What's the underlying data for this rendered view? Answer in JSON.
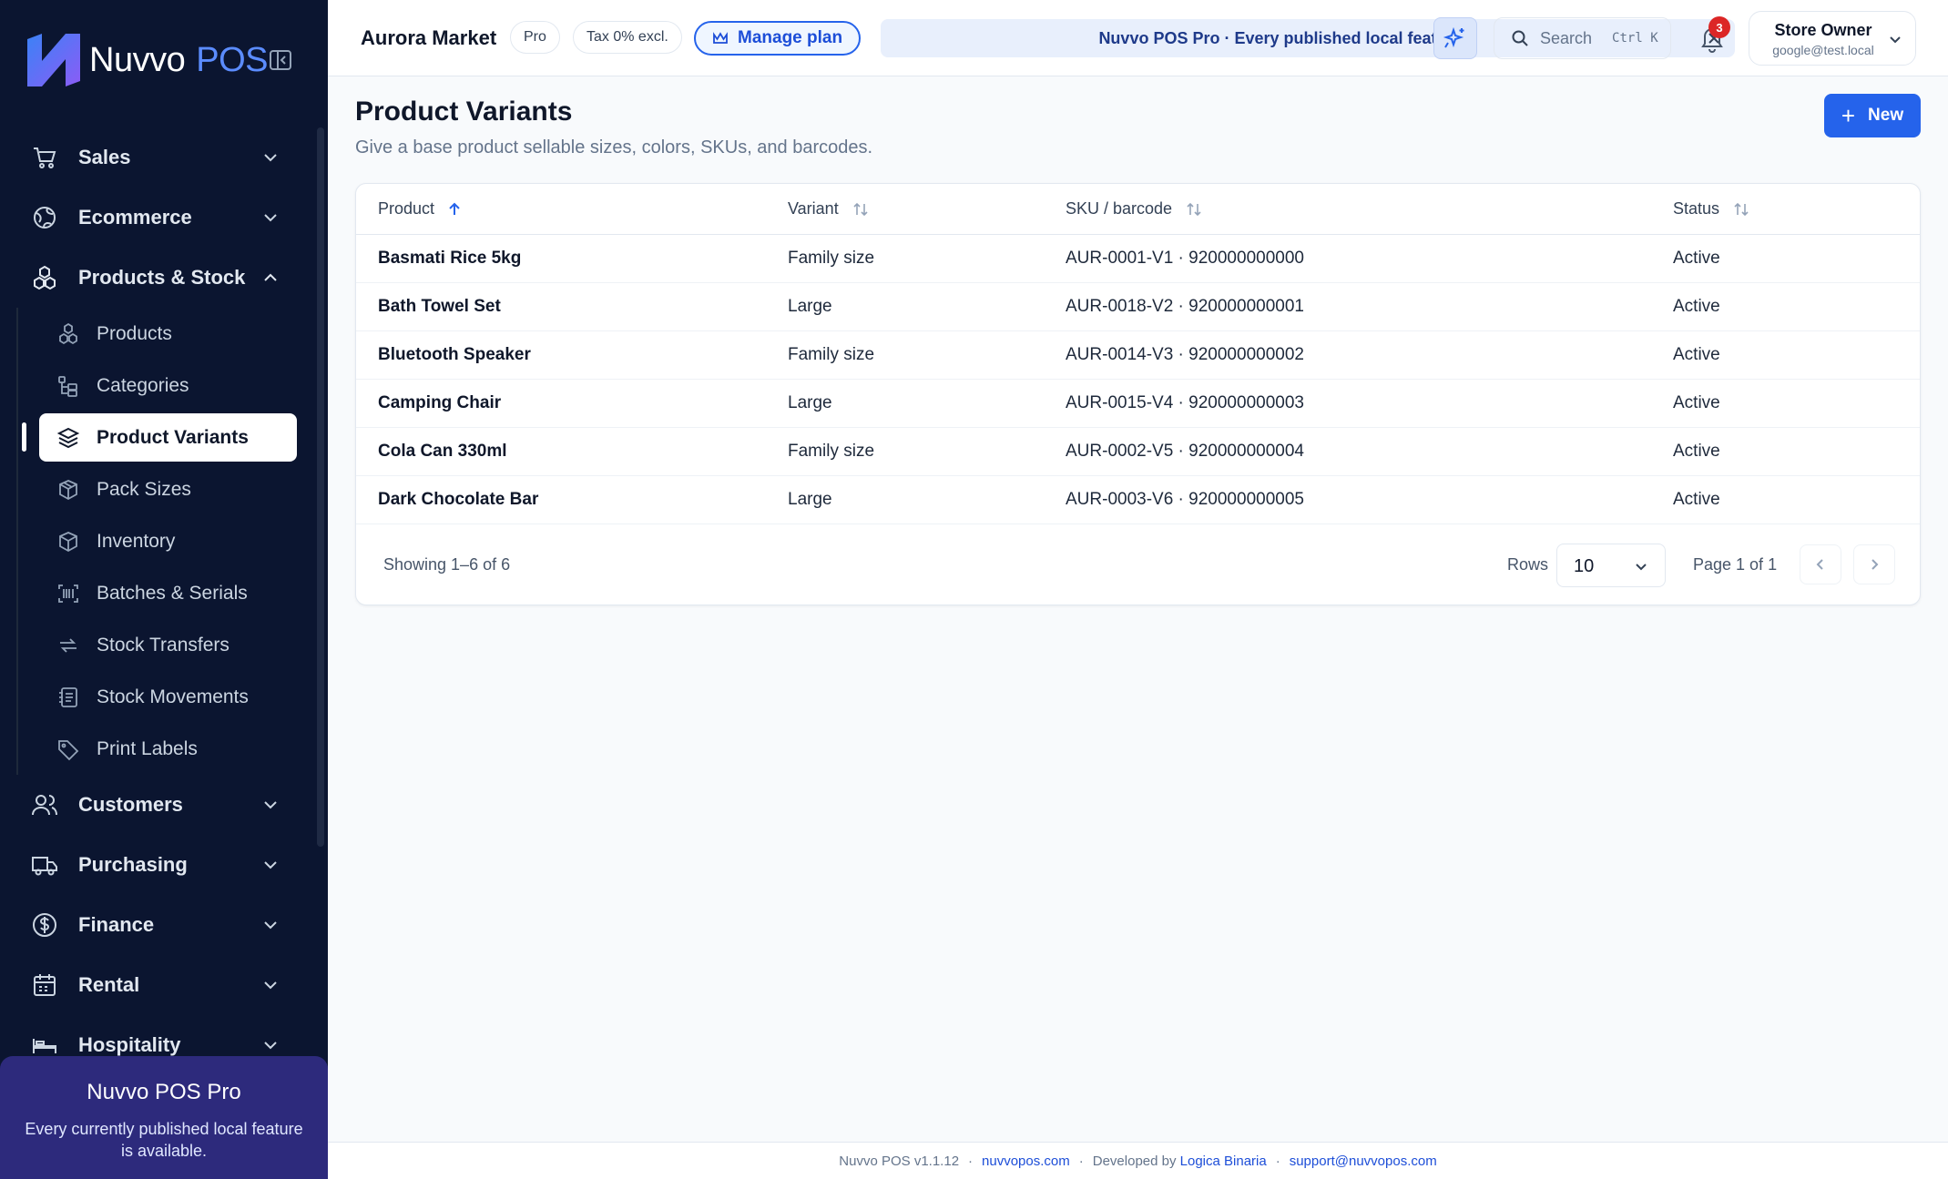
{
  "brand": {
    "name": "Nuvvo",
    "suffix": "POS"
  },
  "sidebar": {
    "groups": [
      {
        "label": "Sales",
        "icon": "cart-icon"
      },
      {
        "label": "Ecommerce",
        "icon": "globe-icon"
      },
      {
        "label": "Products & Stock",
        "icon": "boxes-icon",
        "expanded": true
      },
      {
        "label": "Customers",
        "icon": "users-icon"
      },
      {
        "label": "Purchasing",
        "icon": "truck-icon"
      },
      {
        "label": "Finance",
        "icon": "dollar-icon"
      },
      {
        "label": "Rental",
        "icon": "calendar-icon"
      },
      {
        "label": "Hospitality",
        "icon": "bed-icon"
      }
    ],
    "sub_items": [
      {
        "label": "Products"
      },
      {
        "label": "Categories"
      },
      {
        "label": "Product Variants",
        "active": true
      },
      {
        "label": "Pack Sizes"
      },
      {
        "label": "Inventory"
      },
      {
        "label": "Batches & Serials"
      },
      {
        "label": "Stock Transfers"
      },
      {
        "label": "Stock Movements"
      },
      {
        "label": "Print Labels"
      }
    ],
    "promo": {
      "title": "Nuvvo POS Pro",
      "text": "Every currently published local feature is available."
    }
  },
  "header": {
    "store_name": "Aurora Market",
    "plan_chip": "Pro",
    "tax_chip": "Tax 0% excl.",
    "manage_plan": "Manage plan",
    "banner": "Nuvvo POS Pro · Every published local feature",
    "search_placeholder": "Search",
    "search_shortcut": "Ctrl K",
    "notification_count": "3",
    "user_name": "Store Owner",
    "user_email": "google@test.local"
  },
  "page": {
    "title": "Product Variants",
    "subtitle": "Give a base product sellable sizes, colors, SKUs, and barcodes.",
    "new_button": "New"
  },
  "table": {
    "columns": [
      "Product",
      "Variant",
      "SKU / barcode",
      "Status"
    ],
    "rows": [
      {
        "product": "Basmati Rice 5kg",
        "variant": "Family size",
        "sku": "AUR-0001-V1 · 920000000000",
        "status": "Active"
      },
      {
        "product": "Bath Towel Set",
        "variant": "Large",
        "sku": "AUR-0018-V2 · 920000000001",
        "status": "Active"
      },
      {
        "product": "Bluetooth Speaker",
        "variant": "Family size",
        "sku": "AUR-0014-V3 · 920000000002",
        "status": "Active"
      },
      {
        "product": "Camping Chair",
        "variant": "Large",
        "sku": "AUR-0015-V4 · 920000000003",
        "status": "Active"
      },
      {
        "product": "Cola Can 330ml",
        "variant": "Family size",
        "sku": "AUR-0002-V5 · 920000000004",
        "status": "Active"
      },
      {
        "product": "Dark Chocolate Bar",
        "variant": "Large",
        "sku": "AUR-0003-V6 · 920000000005",
        "status": "Active"
      }
    ],
    "showing": "Showing 1–6 of 6",
    "rows_label": "Rows",
    "rows_value": "10",
    "page_info": "Page 1 of 1"
  },
  "footer": {
    "version": "Nuvvo POS v1.1.12",
    "site": "nuvvopos.com",
    "developed_by": "Developed by",
    "developer": "Logica Binaria",
    "support": "support@nuvvopos.com"
  },
  "colors": {
    "sidebar_bg": "#0b1530",
    "accent": "#2563eb",
    "promo_bg": "#2d2a7c",
    "badge": "#dc2626"
  }
}
